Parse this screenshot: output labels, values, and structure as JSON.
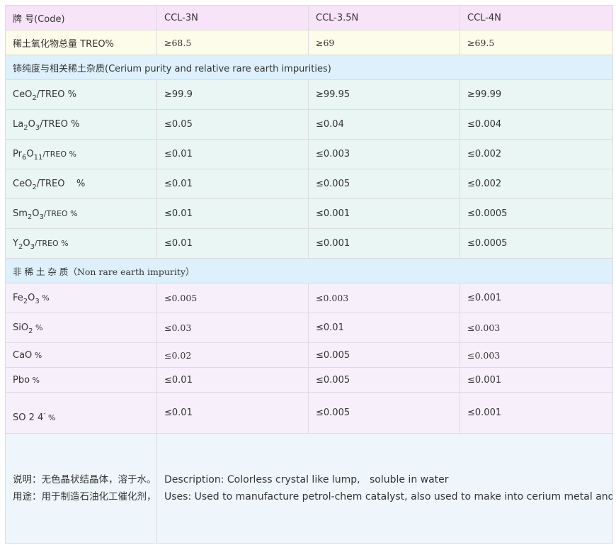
{
  "header": {
    "code_label": "牌 号(Code)",
    "col1": "CCL-3N",
    "col2": "CCL-3.5N",
    "col3": "CCL-4N"
  },
  "treo_row": {
    "label": "稀土氧化物总量 TREO%",
    "v1": "≥68.5",
    "v2": "≥69",
    "v3": "≥69.5"
  },
  "section_cerium": "铈纯度与相关稀土杂质(Cerium purity and relative rare earth impurities)",
  "cerium_rows": [
    {
      "label_pre": "CeO",
      "sub1": "2",
      "mid": "",
      "sub2": "",
      "mid2": "",
      "label_post": "/TREO %",
      "v1": "≥99.9",
      "v2": "≥99.95",
      "v3": "≥99.99"
    },
    {
      "label_pre": "La",
      "sub1": "2",
      "mid": "O",
      "sub2": "3",
      "mid2": "",
      "label_post": "/TREO %",
      "v1": "≤0.05",
      "v2": "≤0.04",
      "v3": "≤0.004"
    },
    {
      "label_pre": "Pr",
      "sub1": "6",
      "mid": "O",
      "sub2": "11",
      "mid2": "",
      "label_post": "/TREO %",
      "v1": "≤0.01",
      "v2": "≤0.003",
      "v3": "≤0.002"
    },
    {
      "label_pre": "CeO",
      "sub1": "2",
      "mid": "",
      "sub2": "",
      "mid2": "",
      "label_post": "/TREO    %",
      "v1": "≤0.01",
      "v2": "≤0.005",
      "v3": "≤0.002"
    },
    {
      "label_pre": "Sm",
      "sub1": "2",
      "mid": "O",
      "sub2": "3",
      "mid2": "",
      "label_post": "/TREO %",
      "v1": "≤0.01",
      "v2": "≤0.001",
      "v3": "≤0.0005"
    },
    {
      "label_pre": "Y",
      "sub1": "2",
      "mid": "O",
      "sub2": "3",
      "mid2": "",
      "label_post": "/TREO %",
      "v1": "≤0.01",
      "v2": "≤0.001",
      "v3": "≤0.0005"
    }
  ],
  "section_non": "非 稀 土 杂 质（Non rare earth impurity）",
  "non_rows": [
    {
      "label_pre": "Fe",
      "sub1": "2",
      "mid": "O",
      "sub2": "3",
      "label_post": " %",
      "v1": "≤0.005",
      "v2": "≤0.003",
      "v3": "≤0.001"
    },
    {
      "label_pre": "SiO",
      "sub1": "2",
      "mid": "",
      "sub2": "",
      "label_post": " %",
      "v1": "≤0.03",
      "v2": "≤0.01",
      "v3": "≤0.003"
    },
    {
      "label_pre": "CaO",
      "sub1": "",
      "mid": "",
      "sub2": "",
      "label_post": " %",
      "v1": "≤0.02",
      "v2": "≤0.005",
      "v3": "≤0.003"
    },
    {
      "label_pre": "Pbo",
      "sub1": "",
      "mid": "",
      "sub2": "",
      "label_post": " %",
      "v1": "≤0.01",
      "v2": "≤0.005",
      "v3": "≤0.001"
    }
  ],
  "so4_row": {
    "label_pre": "SO 2 4",
    "sup": "-",
    "label_post": " %",
    "v1": "≤0.01",
    "v2": "≤0.005",
    "v3": "≤0.001"
  },
  "description": {
    "cn_desc": "说明：无色晶状结晶体，溶于水。",
    "cn_uses": "用途：用于制造石油化工催化剂，也可用来制造金属铈和铈的其它化合物。",
    "en_desc": "Description: Colorless crystal like lump,   soluble in water",
    "en_uses": "Uses: Used to manufacture petrol-chem catalyst, also used to make into cerium metal and other compounds of cerium."
  }
}
